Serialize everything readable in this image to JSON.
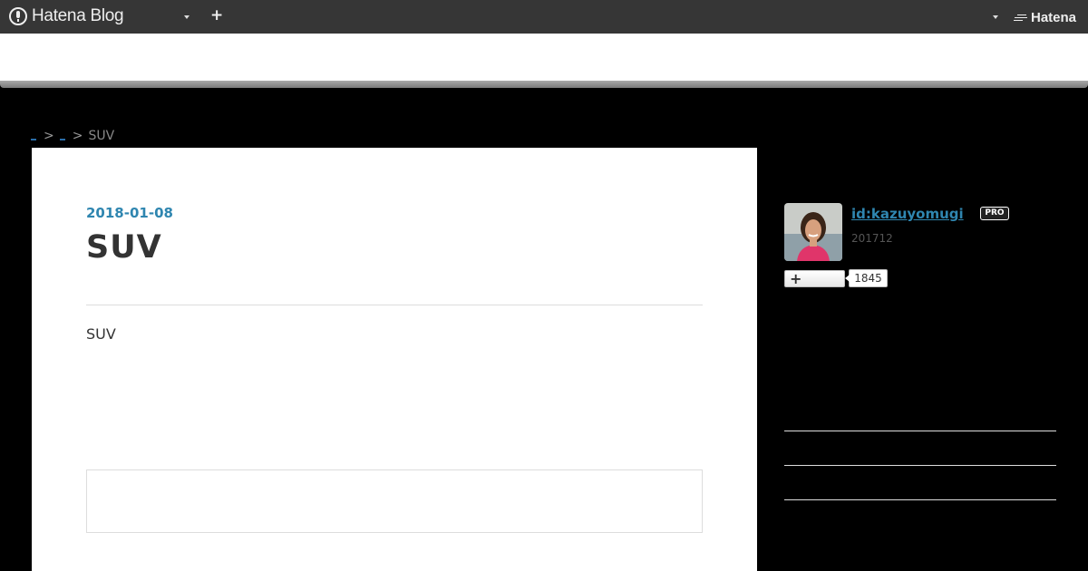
{
  "topbar": {
    "logo_text": "Hatena Blog",
    "add_icon": "plus-icon",
    "brand_text": "Hatena"
  },
  "breadcrumb": {
    "separator": ">",
    "current": "SUV"
  },
  "article": {
    "date": "2018-01-08",
    "title": "SUV",
    "body": "SUV"
  },
  "profile": {
    "user_id": "id:kazuyomugi",
    "badge": "PRO",
    "subtext": "201712",
    "follow_icon": "plus-icon",
    "follower_count": "1845"
  },
  "colors": {
    "topbar_bg": "#363636",
    "page_bg": "#000000",
    "link": "#2f86b0"
  }
}
